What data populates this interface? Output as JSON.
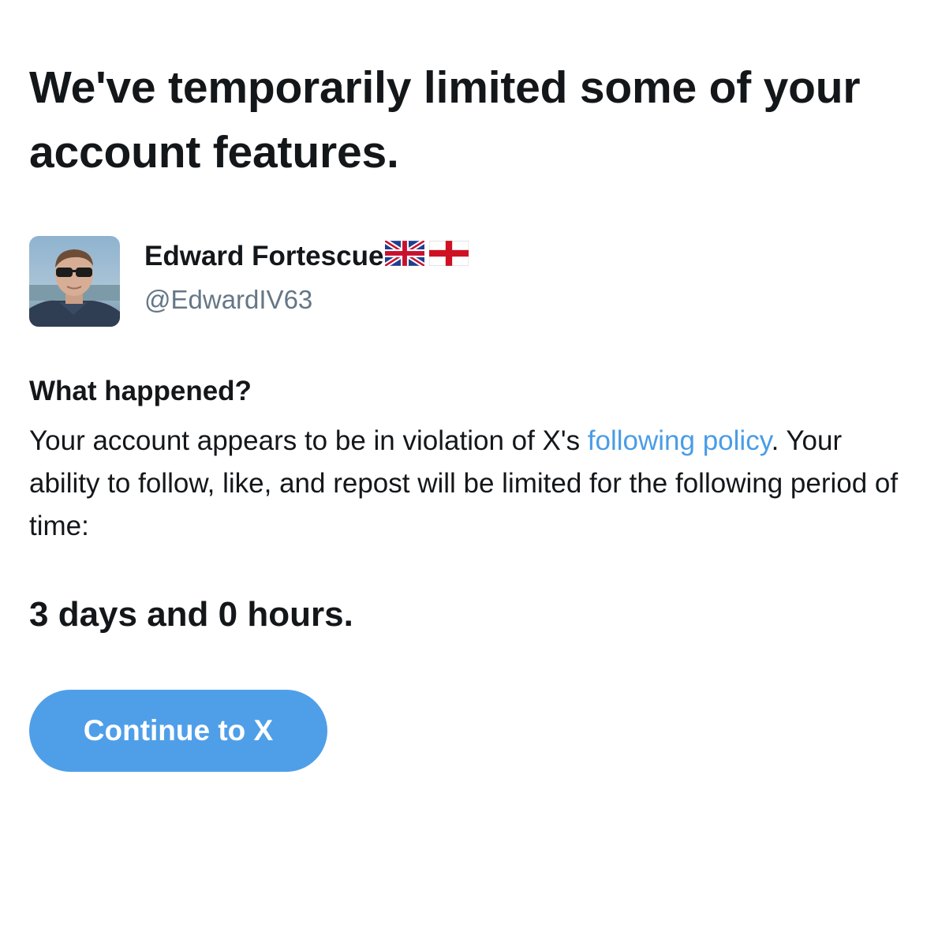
{
  "notice": {
    "title": "We've temporarily limited some of your account features."
  },
  "account": {
    "display_name": "Edward Fortescue",
    "flags": [
      "uk-flag",
      "england-flag"
    ],
    "handle": "@EdwardIV63",
    "avatar": "profile-photo"
  },
  "details": {
    "heading": "What happened?",
    "text_before_link": "Your account appears to be in violation of X's ",
    "link_text": "following policy",
    "text_after_link": ". Your ability to follow, like, and repost will be limited for the following period of time:",
    "duration": "3 days and 0 hours."
  },
  "actions": {
    "continue_label": "Continue to X"
  },
  "colors": {
    "text": "#14171a",
    "secondary_text": "#657786",
    "link": "#4a9ce6",
    "button": "#4f9fe8"
  }
}
